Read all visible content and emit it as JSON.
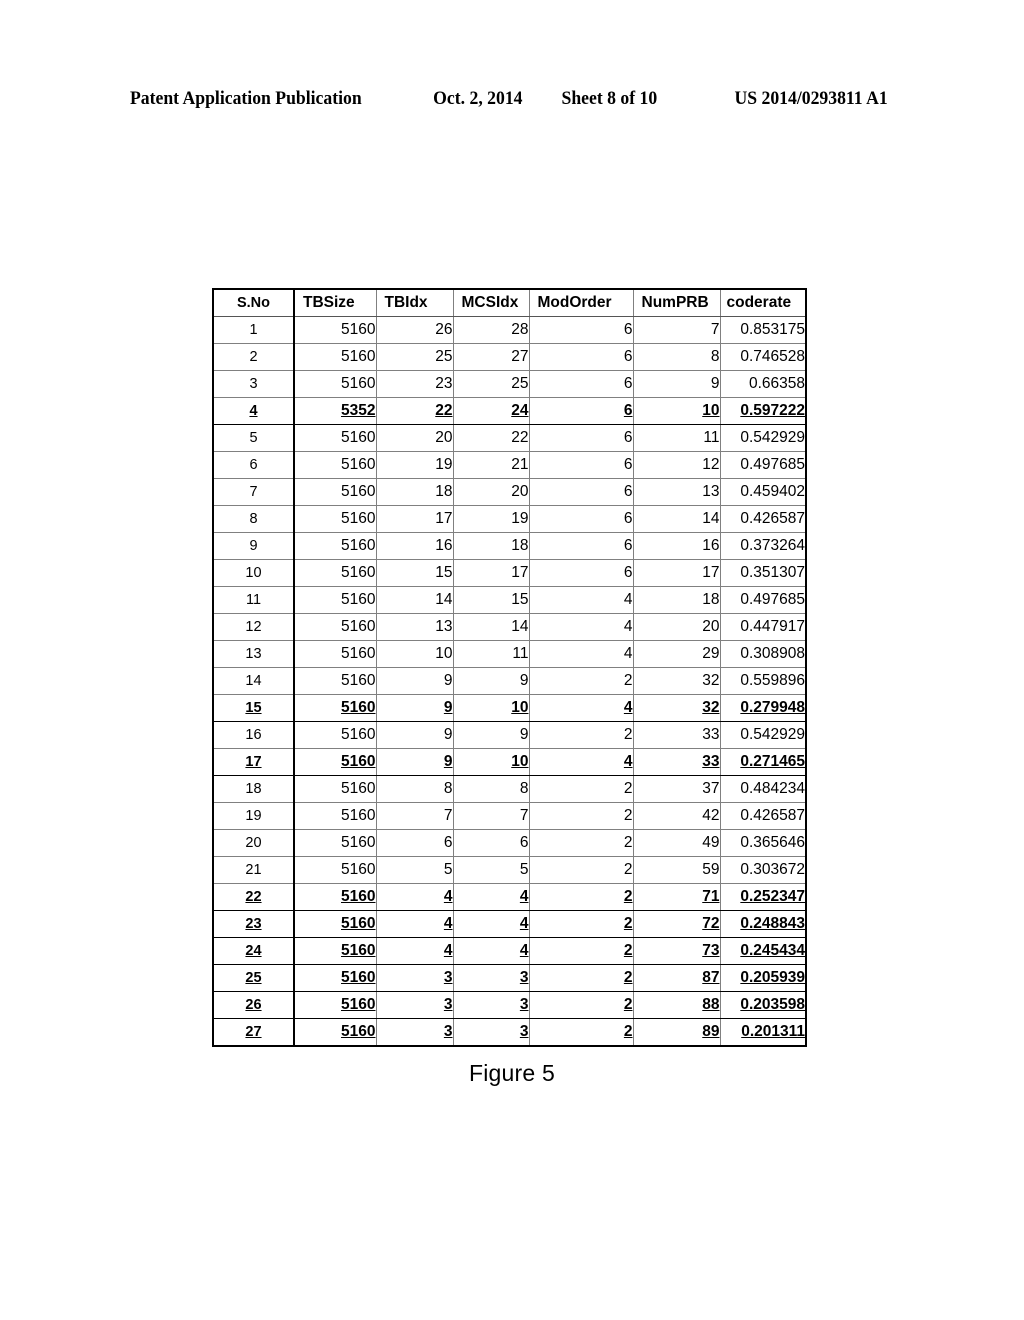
{
  "header": {
    "publication": "Patent Application Publication",
    "date": "Oct. 2, 2014",
    "sheet": "Sheet 8 of 10",
    "doc_number": "US 2014/0293811 A1"
  },
  "figure": {
    "caption": "Figure 5"
  },
  "table": {
    "columns": [
      "S.No",
      "TBSize",
      "TBIdx",
      "MCSIdx",
      "ModOrder",
      "NumPRB",
      "coderate"
    ],
    "rows": [
      {
        "sno": "1",
        "tbsize": "5160",
        "tbidx": "26",
        "mcsidx": "28",
        "modorder": "6",
        "numprb": "7",
        "coderate": "0.853175",
        "highlight": false
      },
      {
        "sno": "2",
        "tbsize": "5160",
        "tbidx": "25",
        "mcsidx": "27",
        "modorder": "6",
        "numprb": "8",
        "coderate": "0.746528",
        "highlight": false
      },
      {
        "sno": "3",
        "tbsize": "5160",
        "tbidx": "23",
        "mcsidx": "25",
        "modorder": "6",
        "numprb": "9",
        "coderate": "0.66358",
        "highlight": false
      },
      {
        "sno": "4",
        "tbsize": "5352",
        "tbidx": "22",
        "mcsidx": "24",
        "modorder": "6",
        "numprb": "10",
        "coderate": "0.597222",
        "highlight": true
      },
      {
        "sno": "5",
        "tbsize": "5160",
        "tbidx": "20",
        "mcsidx": "22",
        "modorder": "6",
        "numprb": "11",
        "coderate": "0.542929",
        "highlight": false
      },
      {
        "sno": "6",
        "tbsize": "5160",
        "tbidx": "19",
        "mcsidx": "21",
        "modorder": "6",
        "numprb": "12",
        "coderate": "0.497685",
        "highlight": false
      },
      {
        "sno": "7",
        "tbsize": "5160",
        "tbidx": "18",
        "mcsidx": "20",
        "modorder": "6",
        "numprb": "13",
        "coderate": "0.459402",
        "highlight": false
      },
      {
        "sno": "8",
        "tbsize": "5160",
        "tbidx": "17",
        "mcsidx": "19",
        "modorder": "6",
        "numprb": "14",
        "coderate": "0.426587",
        "highlight": false
      },
      {
        "sno": "9",
        "tbsize": "5160",
        "tbidx": "16",
        "mcsidx": "18",
        "modorder": "6",
        "numprb": "16",
        "coderate": "0.373264",
        "highlight": false
      },
      {
        "sno": "10",
        "tbsize": "5160",
        "tbidx": "15",
        "mcsidx": "17",
        "modorder": "6",
        "numprb": "17",
        "coderate": "0.351307",
        "highlight": false
      },
      {
        "sno": "11",
        "tbsize": "5160",
        "tbidx": "14",
        "mcsidx": "15",
        "modorder": "4",
        "numprb": "18",
        "coderate": "0.497685",
        "highlight": false
      },
      {
        "sno": "12",
        "tbsize": "5160",
        "tbidx": "13",
        "mcsidx": "14",
        "modorder": "4",
        "numprb": "20",
        "coderate": "0.447917",
        "highlight": false
      },
      {
        "sno": "13",
        "tbsize": "5160",
        "tbidx": "10",
        "mcsidx": "11",
        "modorder": "4",
        "numprb": "29",
        "coderate": "0.308908",
        "highlight": false
      },
      {
        "sno": "14",
        "tbsize": "5160",
        "tbidx": "9",
        "mcsidx": "9",
        "modorder": "2",
        "numprb": "32",
        "coderate": "0.559896",
        "highlight": false
      },
      {
        "sno": "15",
        "tbsize": "5160",
        "tbidx": "9",
        "mcsidx": "10",
        "modorder": "4",
        "numprb": "32",
        "coderate": "0.279948",
        "highlight": true
      },
      {
        "sno": "16",
        "tbsize": "5160",
        "tbidx": "9",
        "mcsidx": "9",
        "modorder": "2",
        "numprb": "33",
        "coderate": "0.542929",
        "highlight": false
      },
      {
        "sno": "17",
        "tbsize": "5160",
        "tbidx": "9",
        "mcsidx": "10",
        "modorder": "4",
        "numprb": "33",
        "coderate": "0.271465",
        "highlight": true
      },
      {
        "sno": "18",
        "tbsize": "5160",
        "tbidx": "8",
        "mcsidx": "8",
        "modorder": "2",
        "numprb": "37",
        "coderate": "0.484234",
        "highlight": false
      },
      {
        "sno": "19",
        "tbsize": "5160",
        "tbidx": "7",
        "mcsidx": "7",
        "modorder": "2",
        "numprb": "42",
        "coderate": "0.426587",
        "highlight": false
      },
      {
        "sno": "20",
        "tbsize": "5160",
        "tbidx": "6",
        "mcsidx": "6",
        "modorder": "2",
        "numprb": "49",
        "coderate": "0.365646",
        "highlight": false
      },
      {
        "sno": "21",
        "tbsize": "5160",
        "tbidx": "5",
        "mcsidx": "5",
        "modorder": "2",
        "numprb": "59",
        "coderate": "0.303672",
        "highlight": false
      },
      {
        "sno": "22",
        "tbsize": "5160",
        "tbidx": "4",
        "mcsidx": "4",
        "modorder": "2",
        "numprb": "71",
        "coderate": "0.252347",
        "highlight": true
      },
      {
        "sno": "23",
        "tbsize": "5160",
        "tbidx": "4",
        "mcsidx": "4",
        "modorder": "2",
        "numprb": "72",
        "coderate": "0.248843",
        "highlight": true
      },
      {
        "sno": "24",
        "tbsize": "5160",
        "tbidx": "4",
        "mcsidx": "4",
        "modorder": "2",
        "numprb": "73",
        "coderate": "0.245434",
        "highlight": true
      },
      {
        "sno": "25",
        "tbsize": "5160",
        "tbidx": "3",
        "mcsidx": "3",
        "modorder": "2",
        "numprb": "87",
        "coderate": "0.205939",
        "highlight": true
      },
      {
        "sno": "26",
        "tbsize": "5160",
        "tbidx": "3",
        "mcsidx": "3",
        "modorder": "2",
        "numprb": "88",
        "coderate": "0.203598",
        "highlight": true
      },
      {
        "sno": "27",
        "tbsize": "5160",
        "tbidx": "3",
        "mcsidx": "3",
        "modorder": "2",
        "numprb": "89",
        "coderate": "0.201311",
        "highlight": true
      }
    ]
  }
}
